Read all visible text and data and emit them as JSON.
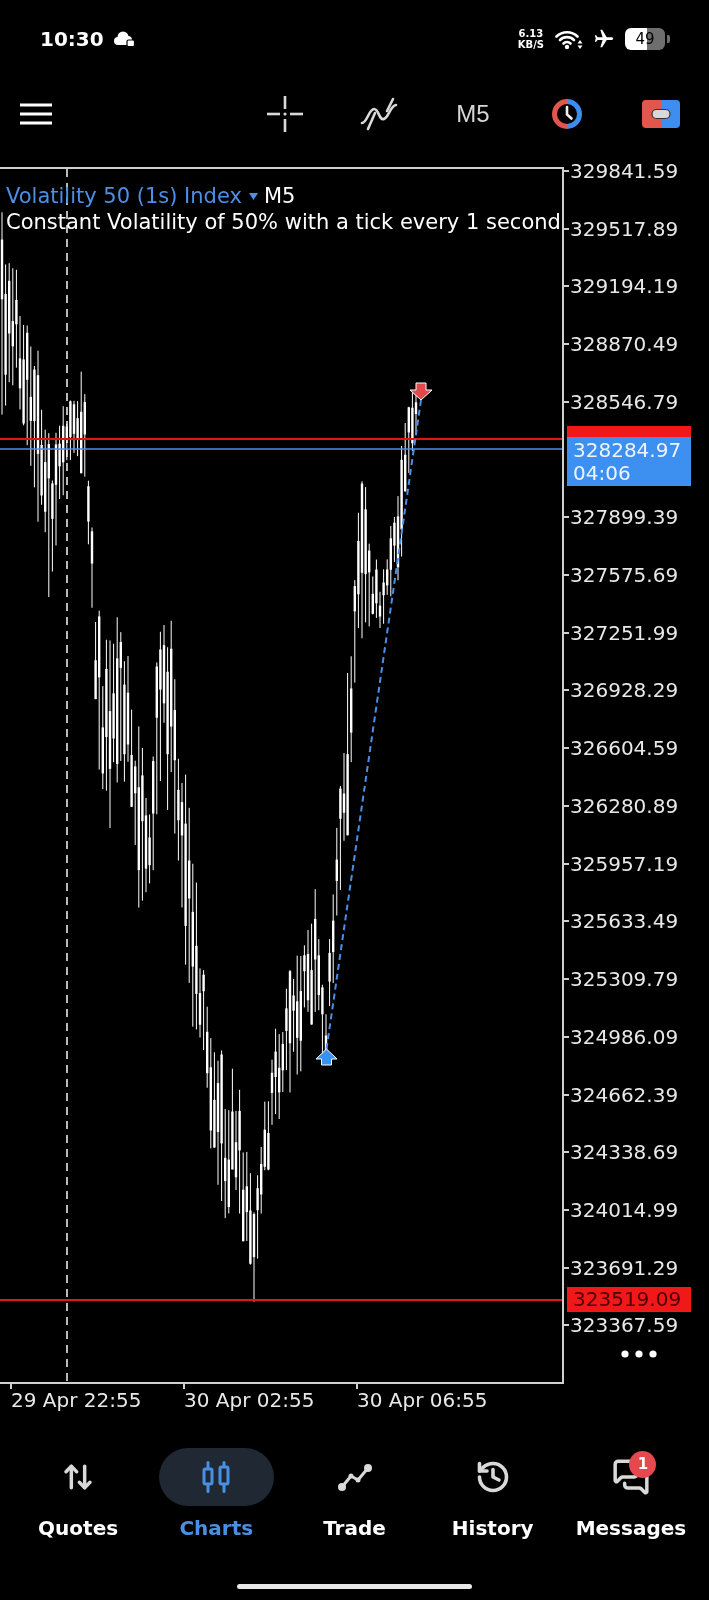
{
  "status_bar": {
    "time": "10:30",
    "net_speed": {
      "value": "6.13",
      "unit": "KB/S"
    },
    "battery": "49"
  },
  "toolbar": {
    "timeframe": "M5"
  },
  "chart": {
    "symbol": "Volatility 50 (1s) Index",
    "timeframe": "M5",
    "description": "Constant Volatility of 50% with a tick every 1 second",
    "price_axis": [
      "329841.59",
      "329517.89",
      "329194.19",
      "328870.49",
      "328546.79",
      "327899.39",
      "327575.69",
      "327251.99",
      "326928.29",
      "326604.59",
      "326280.89",
      "325957.19",
      "325633.49",
      "325309.79",
      "324986.09",
      "324662.39",
      "324338.69",
      "324014.99",
      "323691.29",
      "323367.59"
    ],
    "bid_tag": {
      "price": "328284.97",
      "countdown": "04:06"
    },
    "low_tag": "323519.09",
    "time_axis": [
      "29 Apr 22:55",
      "30 Apr 02:55",
      "30 Apr 06:55"
    ]
  },
  "nav": [
    {
      "label": "Quotes",
      "selected": false
    },
    {
      "label": "Charts",
      "selected": true
    },
    {
      "label": "Trade",
      "selected": false
    },
    {
      "label": "History",
      "selected": false
    },
    {
      "label": "Messages",
      "selected": false,
      "badge": "1"
    }
  ]
}
